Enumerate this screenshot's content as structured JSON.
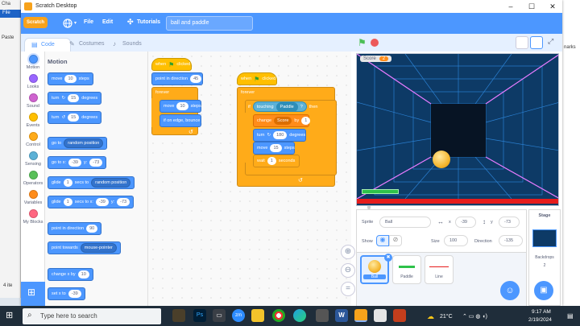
{
  "window": {
    "title": "Scratch Desktop",
    "controls": [
      "–",
      "☐",
      "✕"
    ]
  },
  "background_window": {
    "title": "Cha",
    "file": "File",
    "paste": "Paste",
    "items_count": "4 ite",
    "right_text": "narks"
  },
  "menubar": {
    "logo": "Scratch",
    "file": "File",
    "edit": "Edit",
    "tutorials": "Tutorials",
    "project_title": "ball and paddle"
  },
  "tabs": [
    {
      "label": "Code",
      "active": true
    },
    {
      "label": "Costumes",
      "active": false
    },
    {
      "label": "Sounds",
      "active": false
    }
  ],
  "categories": [
    {
      "label": "Motion",
      "color": "#4c97ff"
    },
    {
      "label": "Looks",
      "color": "#9966ff"
    },
    {
      "label": "Sound",
      "color": "#cf63cf"
    },
    {
      "label": "Events",
      "color": "#ffbf00"
    },
    {
      "label": "Control",
      "color": "#ffab19"
    },
    {
      "label": "Sensing",
      "color": "#5cb1d6"
    },
    {
      "label": "Operators",
      "color": "#59c059"
    },
    {
      "label": "Variables",
      "color": "#ff8c1a"
    },
    {
      "label": "My Blocks",
      "color": "#ff6680"
    }
  ],
  "palette": {
    "title": "Motion",
    "blocks": {
      "move": {
        "pre": "move",
        "val": "10",
        "post": "steps"
      },
      "turn_right": {
        "pre": "turn",
        "val": "15",
        "post": "degrees"
      },
      "turn_left": {
        "pre": "turn",
        "val": "15",
        "post": "degrees"
      },
      "goto_random": {
        "pre": "go to",
        "dd": "random position"
      },
      "goto_xy": {
        "pre": "go to x:",
        "x": "-39",
        "mid": "y:",
        "y": "-73"
      },
      "glide_random": {
        "pre": "glide",
        "val": "1",
        "mid": "secs to",
        "dd": "random position"
      },
      "glide_xy": {
        "pre": "glide",
        "val": "1",
        "mid": "secs to x:",
        "x": "-39",
        "mid2": "y:",
        "y": "-73"
      },
      "point_dir": {
        "pre": "point in direction",
        "val": "90"
      },
      "point_towards": {
        "pre": "point towards",
        "dd": "mouse-pointer"
      },
      "change_x": {
        "pre": "change x by",
        "val": "10"
      },
      "set_x": {
        "pre": "set x to",
        "val": "-39"
      }
    }
  },
  "script1": {
    "hat": "when clicked",
    "point": "point in direction",
    "point_val": "45",
    "forever": "forever",
    "move": "move",
    "move_val": "10",
    "move_post": "steps",
    "bounce": "if on edge, bounce"
  },
  "script2": {
    "hat": "when clicked",
    "forever": "forever",
    "if": "if",
    "touching": "touching",
    "touching_dd": "Paddle",
    "q": "?",
    "then": "then",
    "change": "change",
    "change_dd": "Score",
    "by": "by",
    "by_val": "1",
    "turn": "turn",
    "turn_val": "180",
    "turn_post": "degrees",
    "move": "move",
    "move_val": "15",
    "move_post": "steps",
    "wait": "wait",
    "wait_val": "1",
    "wait_post": "seconds"
  },
  "stage": {
    "score_label": "Score",
    "score_value": "2"
  },
  "sprite_info": {
    "sprite_label": "Sprite",
    "sprite_name": "Ball",
    "x_label": "x",
    "x": "-39",
    "y_label": "y",
    "y": "-73",
    "show_label": "Show",
    "size_label": "Size",
    "size": "100",
    "direction_label": "Direction",
    "direction": "-135"
  },
  "sprites": [
    {
      "name": "Ball",
      "selected": true
    },
    {
      "name": "Paddle",
      "selected": false
    },
    {
      "name": "Line",
      "selected": false
    }
  ],
  "stage_panel": {
    "title": "Stage",
    "backdrops_label": "Backdrops",
    "backdrops_count": "2"
  },
  "taskbar": {
    "search_placeholder": "Type here to search",
    "weather": "21°C",
    "time": "9:17 AM",
    "date": "2/19/2024"
  }
}
